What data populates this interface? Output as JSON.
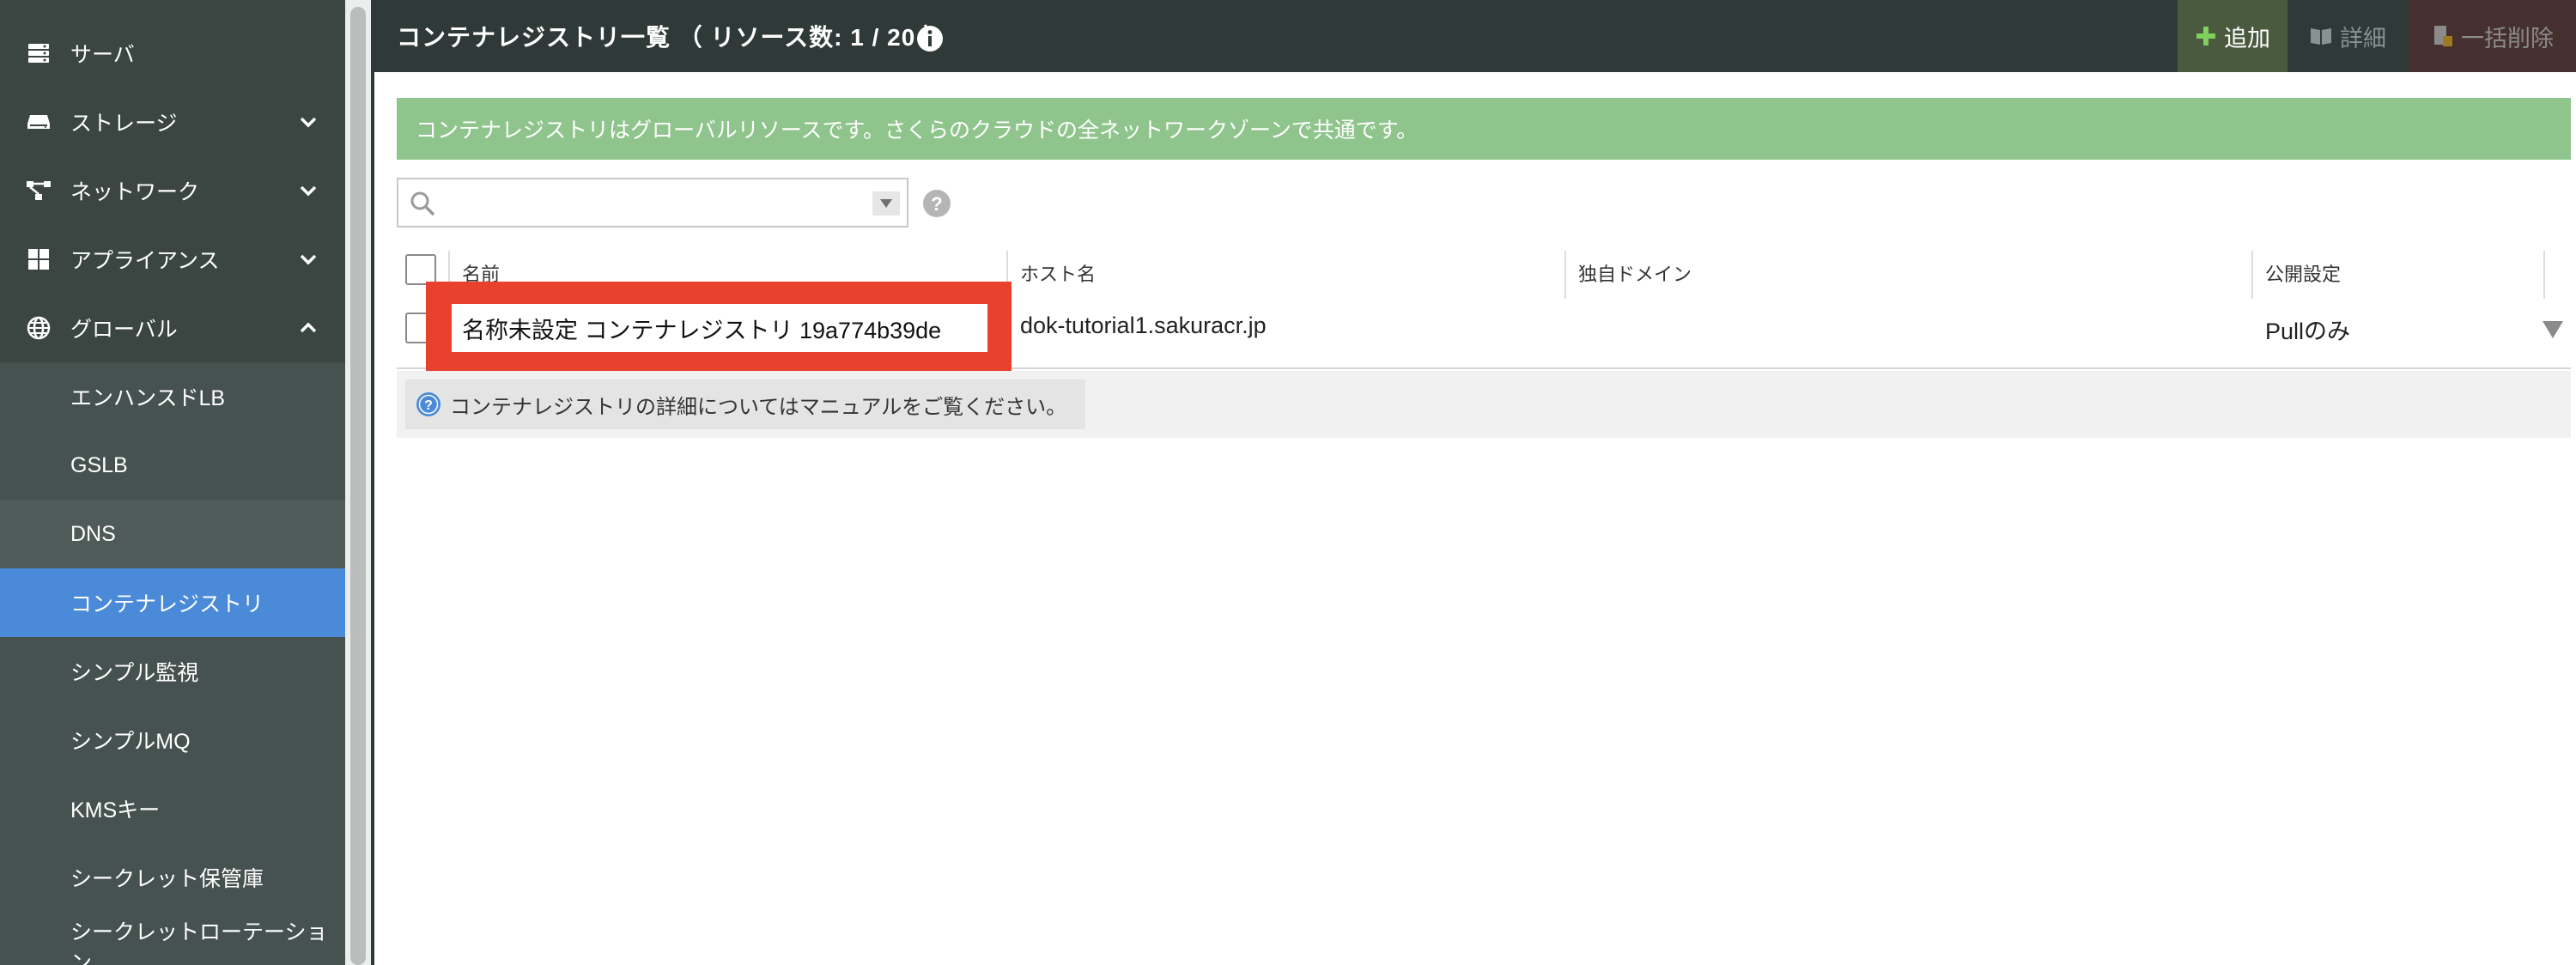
{
  "sidebar": {
    "items": [
      {
        "label": "サーバ",
        "icon": "server-icon"
      },
      {
        "label": "ストレージ",
        "icon": "storage-icon"
      },
      {
        "label": "ネットワーク",
        "icon": "network-icon"
      },
      {
        "label": "アプライアンス",
        "icon": "appliance-icon"
      },
      {
        "label": "グローバル",
        "icon": "globe-icon"
      }
    ],
    "sub_items": [
      {
        "label": "エンハンスドLB"
      },
      {
        "label": "GSLB"
      },
      {
        "label": "DNS"
      },
      {
        "label": "コンテナレジストリ"
      },
      {
        "label": "シンプル監視"
      },
      {
        "label": "シンプルMQ"
      },
      {
        "label": "KMSキー"
      },
      {
        "label": "シークレット保管庫"
      },
      {
        "label": "シークレットローテーション"
      }
    ]
  },
  "header": {
    "title": "コンテナレジストリ一覧 （ リソース数: 1 / 20 ）",
    "buttons": {
      "add": "追加",
      "detail": "詳細",
      "bulk_delete": "一括削除"
    }
  },
  "banner": {
    "text": "コンテナレジストリはグローバルリソースです。さくらのクラウドの全ネットワークゾーンで共通です。"
  },
  "search": {
    "value": "",
    "placeholder": ""
  },
  "table": {
    "columns": [
      "名前",
      "ホスト名",
      "独自ドメイン",
      "公開設定"
    ],
    "rows": [
      {
        "name": "名称未設定 コンテナレジストリ 19a774b39de",
        "host": "dok-tutorial1.sakuracr.jp",
        "domain": "",
        "visibility": "Pullのみ"
      }
    ]
  },
  "footer": {
    "note": "コンテナレジストリの詳細についてはマニュアルをご覧ください。"
  },
  "colors": {
    "sidebar_bg": "#3b4542",
    "active": "#4a8ad8",
    "banner": "#8fc58c",
    "highlight": "#e8412d",
    "header_bg": "#2f3938"
  }
}
